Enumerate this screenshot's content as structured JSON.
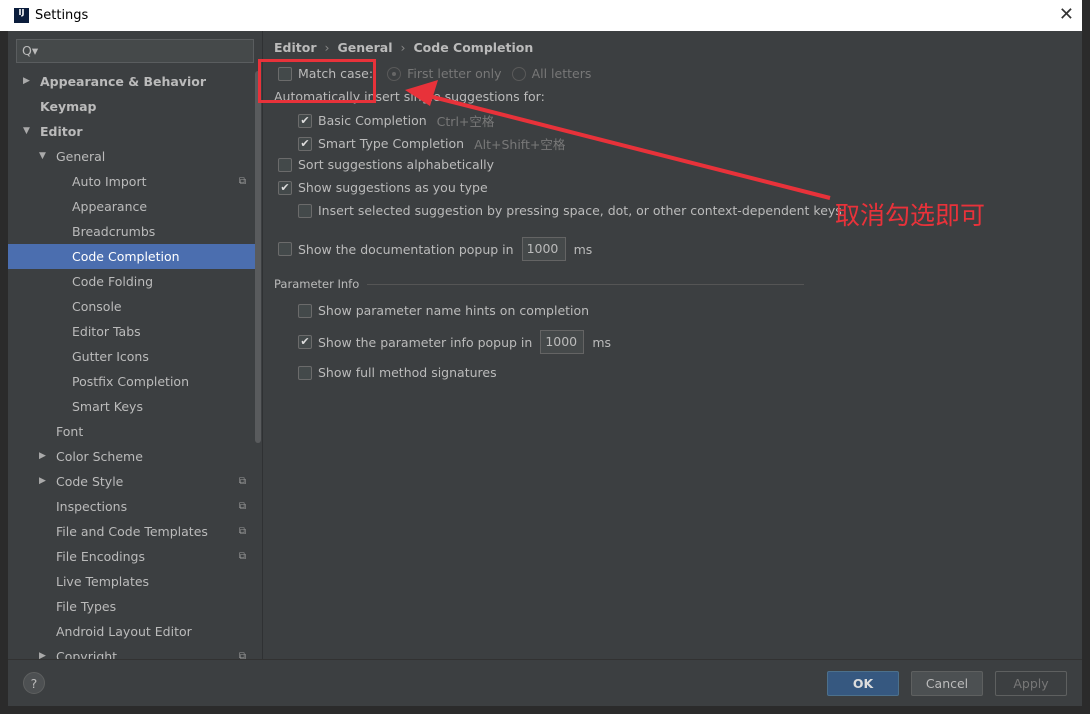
{
  "window": {
    "title": "Settings"
  },
  "search": {
    "placeholder": "Q▾"
  },
  "tree": [
    {
      "label": "Appearance & Behavior",
      "level": 0,
      "bold": true,
      "arrow": "right"
    },
    {
      "label": "Keymap",
      "level": 0,
      "bold": true
    },
    {
      "label": "Editor",
      "level": 0,
      "bold": true,
      "arrow": "down"
    },
    {
      "label": "General",
      "level": 1,
      "arrow": "down"
    },
    {
      "label": "Auto Import",
      "level": 2,
      "copy": true
    },
    {
      "label": "Appearance",
      "level": 2
    },
    {
      "label": "Breadcrumbs",
      "level": 2
    },
    {
      "label": "Code Completion",
      "level": 2,
      "selected": true
    },
    {
      "label": "Code Folding",
      "level": 2
    },
    {
      "label": "Console",
      "level": 2
    },
    {
      "label": "Editor Tabs",
      "level": 2
    },
    {
      "label": "Gutter Icons",
      "level": 2
    },
    {
      "label": "Postfix Completion",
      "level": 2
    },
    {
      "label": "Smart Keys",
      "level": 2
    },
    {
      "label": "Font",
      "level": 1
    },
    {
      "label": "Color Scheme",
      "level": 1,
      "arrow": "right"
    },
    {
      "label": "Code Style",
      "level": 1,
      "arrow": "right",
      "copy": true
    },
    {
      "label": "Inspections",
      "level": 1,
      "copy": true
    },
    {
      "label": "File and Code Templates",
      "level": 1,
      "copy": true
    },
    {
      "label": "File Encodings",
      "level": 1,
      "copy": true
    },
    {
      "label": "Live Templates",
      "level": 1
    },
    {
      "label": "File Types",
      "level": 1
    },
    {
      "label": "Android Layout Editor",
      "level": 1
    },
    {
      "label": "Copyright",
      "level": 1,
      "arrow": "right",
      "copy": true
    }
  ],
  "breadcrumb": [
    "Editor",
    "General",
    "Code Completion"
  ],
  "options": {
    "match_case": {
      "label": "Match case:",
      "checked": false
    },
    "first_letter": {
      "label": "First letter only",
      "selected": true
    },
    "all_letters": {
      "label": "All letters",
      "selected": false
    },
    "auto_insert": "Automatically insert single suggestions for:",
    "basic": {
      "label": "Basic Completion",
      "shortcut": "Ctrl+空格",
      "checked": true
    },
    "smart": {
      "label": "Smart Type Completion",
      "shortcut": "Alt+Shift+空格",
      "checked": true
    },
    "sort": {
      "label": "Sort suggestions alphabetically",
      "checked": false
    },
    "show_as_type": {
      "label": "Show suggestions as you type",
      "checked": true
    },
    "insert_selected": {
      "label": "Insert selected suggestion by pressing space, dot, or other context-dependent keys",
      "checked": false
    },
    "doc_popup": {
      "label": "Show the documentation popup in",
      "value": "1000",
      "unit": "ms",
      "checked": false
    }
  },
  "param_info": {
    "title": "Parameter Info",
    "name_hints": {
      "label": "Show parameter name hints on completion",
      "checked": false
    },
    "info_popup": {
      "label": "Show the parameter info popup in",
      "value": "1000",
      "unit": "ms",
      "checked": true
    },
    "full_sig": {
      "label": "Show full method signatures",
      "checked": false
    }
  },
  "buttons": {
    "help": "?",
    "ok": "OK",
    "cancel": "Cancel",
    "apply": "Apply"
  },
  "annotation": {
    "text": "取消勾选即可",
    "color": "#e8323a"
  }
}
